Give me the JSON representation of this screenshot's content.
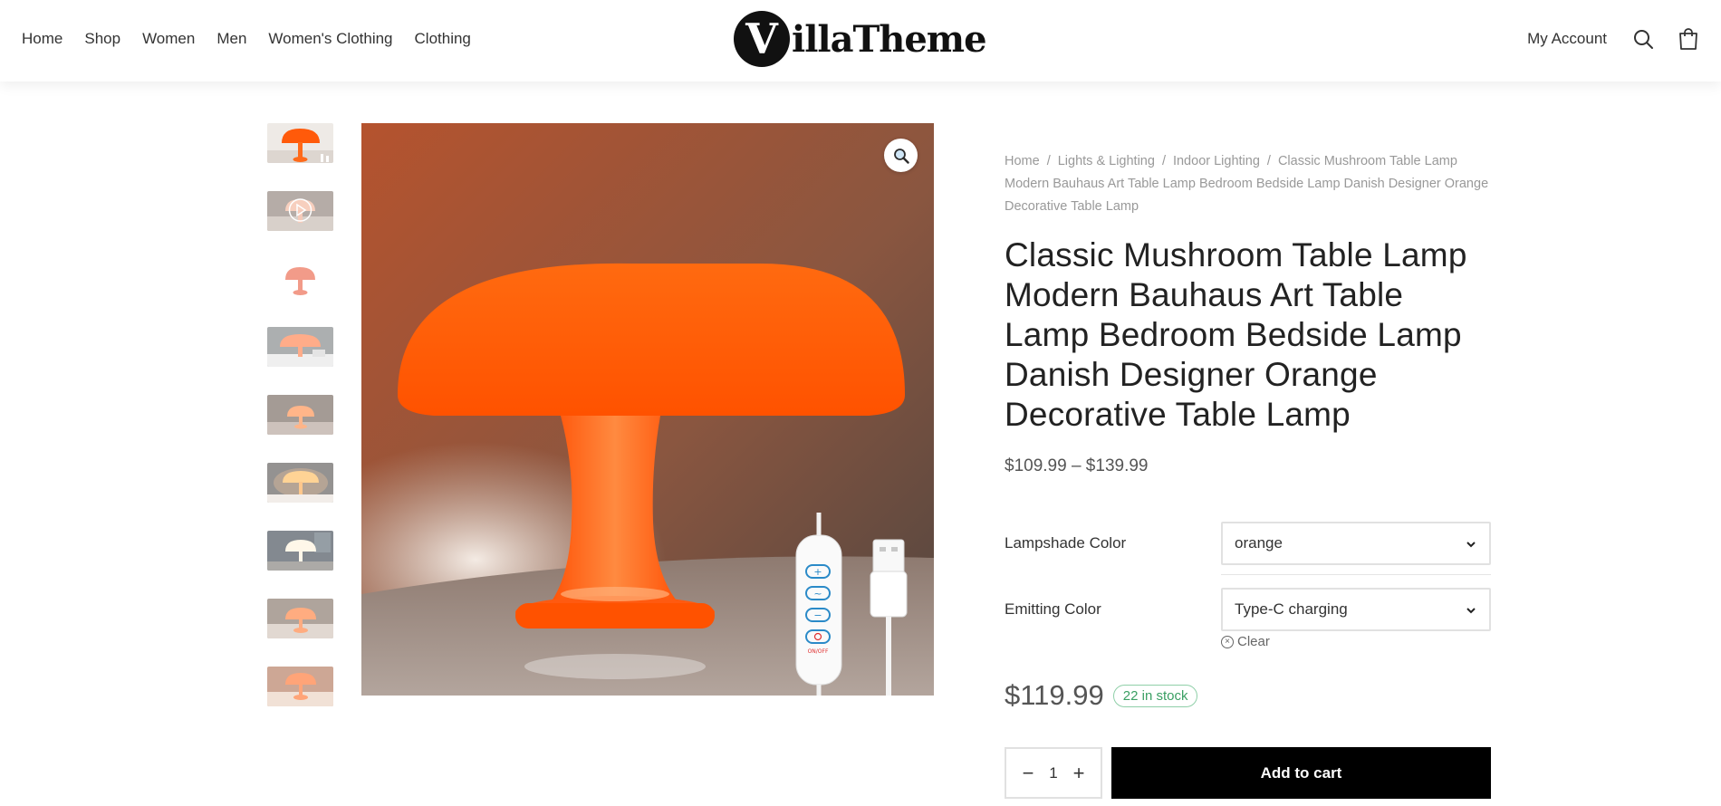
{
  "header": {
    "nav": [
      "Home",
      "Shop",
      "Women",
      "Men",
      "Women's Clothing",
      "Clothing"
    ],
    "logo_mark": "V",
    "logo_text": "illaTheme",
    "account_label": "My Account",
    "icons": [
      "search-icon",
      "cart-icon"
    ]
  },
  "gallery": {
    "thumbnails": [
      {
        "subject": "orange lamp",
        "video": false
      },
      {
        "subject": "video",
        "video": true
      },
      {
        "subject": "pink lamp",
        "video": false
      },
      {
        "subject": "orange lamp on shelf",
        "video": false
      },
      {
        "subject": "orange lamp on desk",
        "video": false
      },
      {
        "subject": "lit orange lamp",
        "video": false
      },
      {
        "subject": "white lamp",
        "video": false
      },
      {
        "subject": "orange lamp",
        "video": false
      },
      {
        "subject": "orange lamp glow",
        "video": false
      }
    ],
    "zoom_icon": "zoom-icon",
    "main_image": "orange mushroom table lamp with USB dimmer cable",
    "remote_labels": [
      "+",
      "~",
      "−",
      "ON/OFF"
    ]
  },
  "breadcrumb": [
    "Home",
    "Lights & Lighting",
    "Indoor Lighting",
    "Classic Mushroom Table Lamp Modern Bauhaus Art Table Lamp Bedroom Bedside Lamp Danish Designer Orange Decorative Table Lamp"
  ],
  "product": {
    "title": "Classic Mushroom Table Lamp Modern Bauhaus Art Table Lamp Bedroom Bedside Lamp Danish Designer Orange Decorative Table Lamp",
    "price_range": "$109.99 – $139.99",
    "variations": [
      {
        "label": "Lampshade Color",
        "value": "orange"
      },
      {
        "label": "Emitting Color",
        "value": "Type-C charging"
      }
    ],
    "clear_label": "Clear",
    "price": "$119.99",
    "stock": "22 in stock",
    "quantity": "1",
    "add_to_cart": "Add to cart"
  },
  "colors": {
    "lamp_orange": "#ff5a0a",
    "stock_green": "#3a9f63",
    "button_black": "#000000"
  }
}
